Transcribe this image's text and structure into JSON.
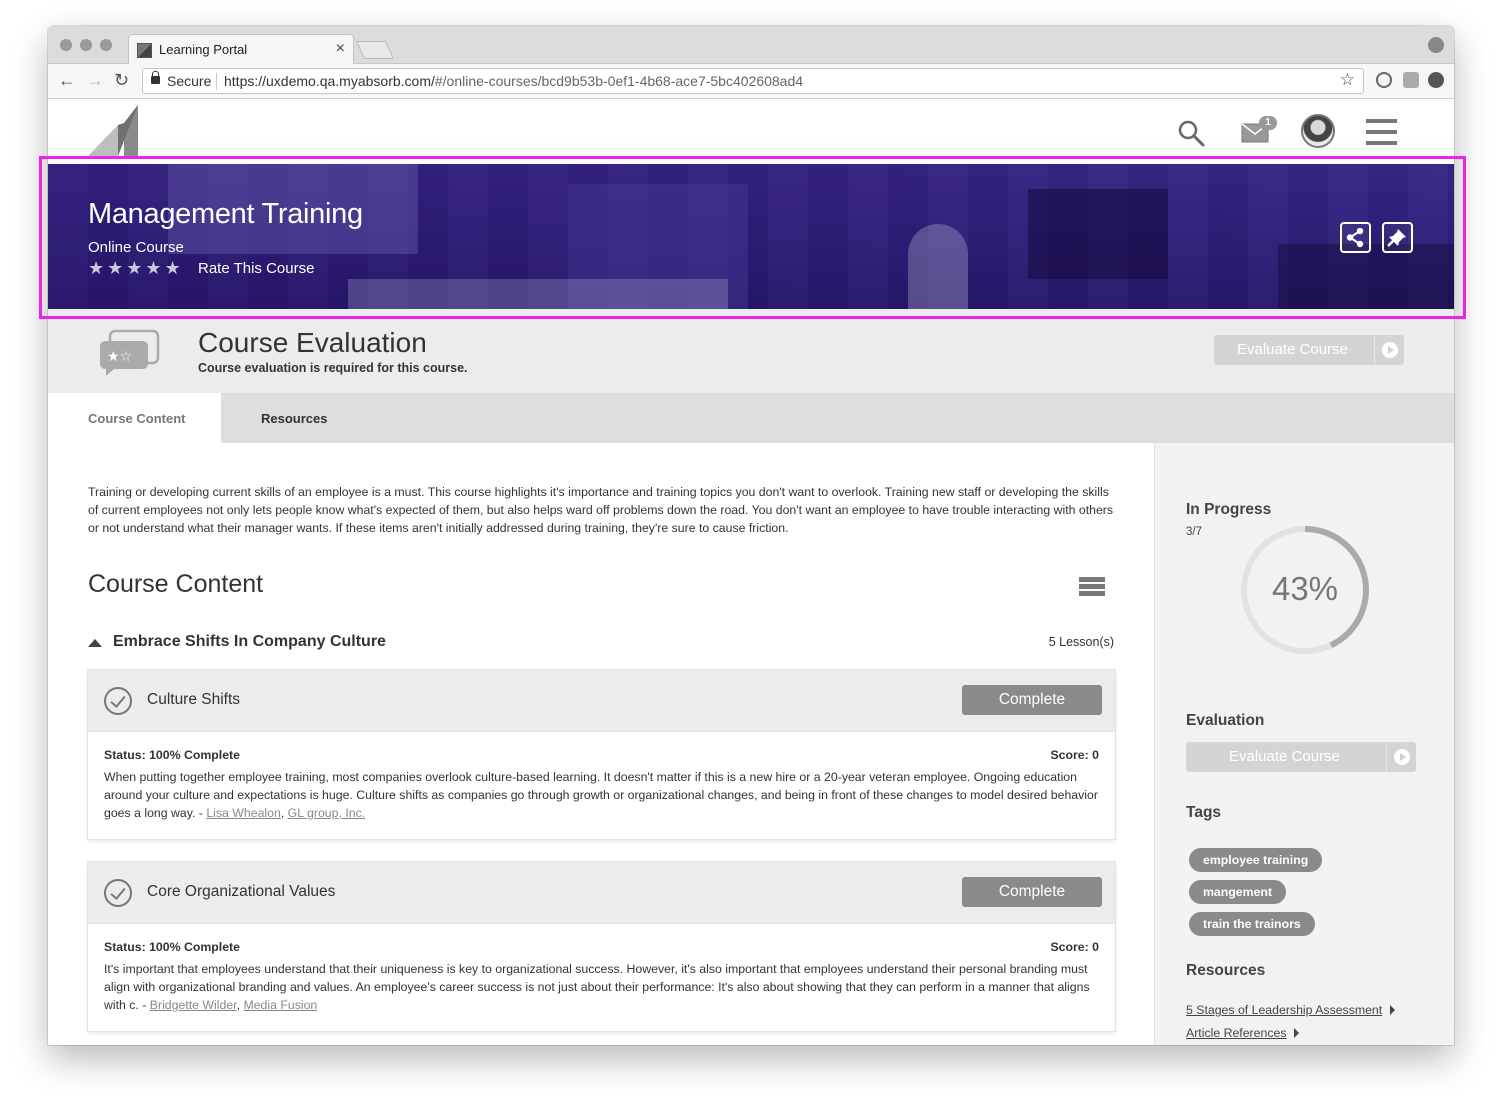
{
  "browser": {
    "tab_title": "Learning Portal",
    "tab_close": "×",
    "secure_label": "Secure",
    "url_host": "https://uxdemo.qa.myabsorb.com/",
    "url_path": "#/online-courses/bcd9b53b-0ef1-4b68-ace7-5bc402608ad4",
    "back_glyph": "←",
    "forward_glyph": "→",
    "reload_glyph": "↻",
    "bookmark_glyph": "☆"
  },
  "header": {
    "notification_count": "1",
    "icons": [
      "search-icon",
      "mail-icon",
      "avatar",
      "menu-icon"
    ]
  },
  "banner": {
    "title": "Management Training",
    "subtitle": "Online Course",
    "rating_stars": "★★★★★",
    "rate_label": "Rate This Course",
    "icons": [
      "share-icon",
      "pin-icon"
    ]
  },
  "evaluation": {
    "title": "Course Evaluation",
    "required_text": "Course evaluation is required for this course.",
    "button_label": "Evaluate Course"
  },
  "tabs": [
    {
      "label": "Course Content",
      "active": true
    },
    {
      "label": "Resources",
      "active": false
    }
  ],
  "main": {
    "description": "Training or developing current skills of an employee is a must. This course highlights it's importance and training topics you don't want to overlook. Training new staff or developing the skills of current employees not only lets people know what's expected of them, but also helps ward off problems down the road. You don't want an employee to have trouble interacting with others or not understand what their manager wants. If these items aren't initially addressed during training, they're sure to cause friction.",
    "content_title": "Course Content",
    "module": {
      "title": "Embrace Shifts In Company Culture",
      "lesson_count": "5 Lesson(s)"
    },
    "lessons": [
      {
        "name": "Culture Shifts",
        "button": "Complete",
        "status": "Status: 100% Complete",
        "score": "Score: 0",
        "description": "When putting together employee training, most companies overlook culture-based learning. It doesn't matter if this is a new hire or a 20-year veteran employee. Ongoing education around your culture and expectations is huge. Culture shifts as companies go through growth or organizational changes, and being in front of these changes to model desired behavior goes a long way. - ",
        "author": "Lisa Whealon",
        "org": "GL group, Inc. "
      },
      {
        "name": "Core Organizational Values",
        "button": "Complete",
        "status": "Status: 100% Complete",
        "score": "Score: 0",
        "description": "It's important that employees understand that their uniqueness is key to organizational success. However, it's also important that employees understand their personal branding must align with organizational branding and values. An employee's career success is not just about their performance: It's also about showing that they can perform in a manner that aligns with c. - ",
        "author": "Bridgette Wilder",
        "org": "Media Fusion "
      }
    ]
  },
  "sidebar": {
    "progress_heading": "In Progress",
    "progress_count": "3/7",
    "progress_percent": 43,
    "progress_label": "43%",
    "evaluation_heading": "Evaluation",
    "evaluation_button": "Evaluate Course",
    "tags_heading": "Tags",
    "tags": [
      "employee training",
      "mangement",
      "train the trainors"
    ],
    "resources_heading": "Resources",
    "resources": [
      "5 Stages of Leadership Assessment",
      "Article References"
    ]
  },
  "colors": {
    "banner": "#2e2077",
    "highlight": "#ee22ee",
    "button_gray": "#8a8a8a",
    "disabled_button": "#d4d4d4"
  }
}
